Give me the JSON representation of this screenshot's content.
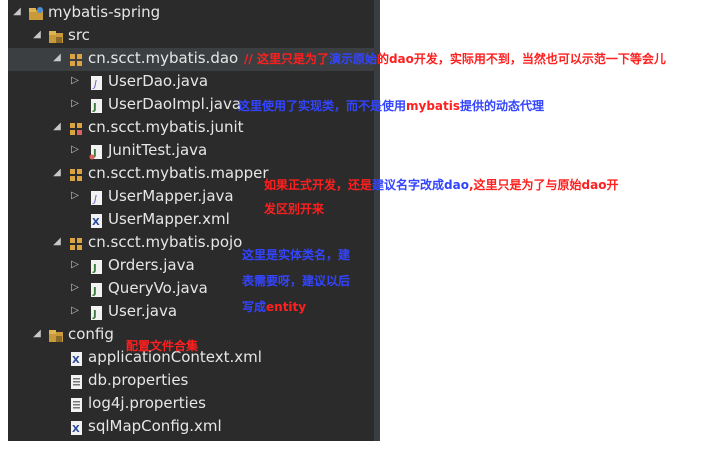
{
  "colors": {
    "tree_bg": "#2b2b2b",
    "text": "#e6e6e6",
    "note_red": "#ff1f1f",
    "note_blue": "#3344ff",
    "icon_folder": "#d9a441",
    "icon_java": "#e0c873"
  },
  "tree": {
    "project": {
      "label": "mybatis-spring"
    },
    "src": {
      "label": "src"
    },
    "pkg_dao": {
      "label": "cn.scct.mybatis.dao"
    },
    "user_dao": {
      "label": "UserDao.java"
    },
    "user_dao_impl": {
      "label": "UserDaoImpl.java"
    },
    "pkg_junit": {
      "label": "cn.scct.mybatis.junit"
    },
    "junit_test": {
      "label": "JunitTest.java"
    },
    "pkg_mapper": {
      "label": "cn.scct.mybatis.mapper"
    },
    "user_mapper_java": {
      "label": "UserMapper.java"
    },
    "user_mapper_xml": {
      "label": "UserMapper.xml"
    },
    "pkg_pojo": {
      "label": "cn.scct.mybatis.pojo"
    },
    "orders": {
      "label": "Orders.java"
    },
    "query_vo": {
      "label": "QueryVo.java"
    },
    "user": {
      "label": "User.java"
    },
    "config": {
      "label": "config"
    },
    "app_ctx": {
      "label": "applicationContext.xml"
    },
    "db_props": {
      "label": "db.properties"
    },
    "log4j": {
      "label": "log4j.properties"
    },
    "sql_map": {
      "label": "sqlMapConfig.xml"
    }
  },
  "notes": {
    "dao_a": "// 这里只是为了",
    "dao_b": "演示原始",
    "dao_c": "的dao开发，实际用不到，当然也可以示范一下等会儿",
    "impl_a": "这里使用了实现类，而不是使用",
    "impl_b": "mybatis",
    "impl_c": "提供的动态代理",
    "mapper_a": "如果正式开发，还是",
    "mapper_b": "建议名字改成",
    "mapper_c": "dao",
    "mapper_d": ",这里只是为了与原始dao开",
    "mapper_e": "发区别开来",
    "pojo_1": "这里是实体类名，建",
    "pojo_2": "表需要呀，建议以后",
    "pojo_3a": "写成",
    "pojo_3b": "entity",
    "config_note": "配置文件合集"
  }
}
